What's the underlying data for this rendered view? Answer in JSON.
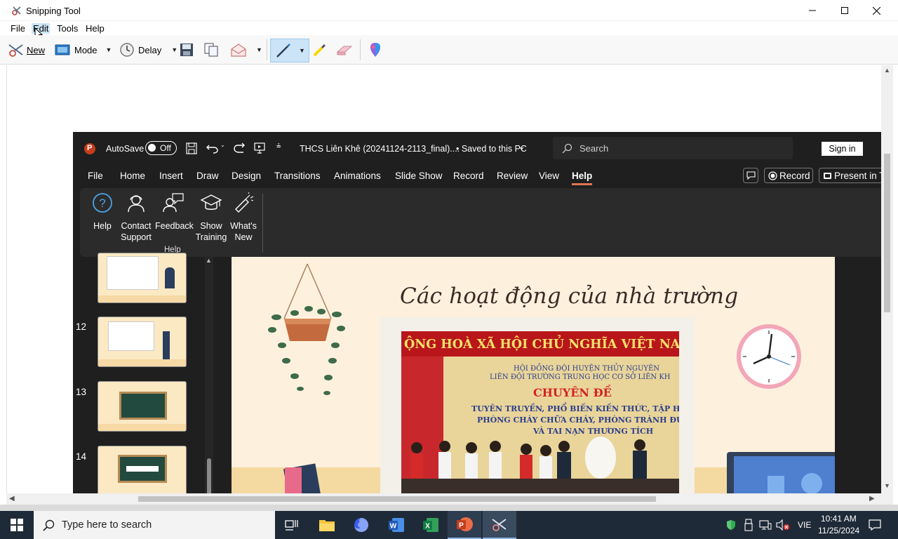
{
  "window": {
    "title": "Snipping Tool",
    "menu": [
      "File",
      "Edit",
      "Tools",
      "Help"
    ],
    "toolbar": {
      "new_label": "New",
      "mode_label": "Mode",
      "delay_label": "Delay"
    }
  },
  "ppt": {
    "autosave_label": "AutoSave",
    "toggle_state": "Off",
    "doc_title": "THCS Liên Khê (20241124-2113_final)....",
    "saved_status": "• Saved to this PC",
    "search_placeholder": "Search",
    "signin_label": "Sign in",
    "tabs": [
      "File",
      "Home",
      "Insert",
      "Draw",
      "Design",
      "Transitions",
      "Animations",
      "Slide Show",
      "Record",
      "Review",
      "View",
      "Help"
    ],
    "active_tab": "Help",
    "record_btn": "Record",
    "present_btn": "Present in T",
    "ribbon": {
      "items": [
        {
          "l1": "Help",
          "l2": ""
        },
        {
          "l1": "Contact",
          "l2": "Support"
        },
        {
          "l1": "Feedback",
          "l2": ""
        },
        {
          "l1": "Show",
          "l2": "Training"
        },
        {
          "l1": "What's",
          "l2": "New"
        }
      ],
      "group_label": "Help"
    },
    "slide_numbers": [
      "12",
      "13",
      "14"
    ],
    "slide_title": "Các hoạt động của nhà trường",
    "banner_line1": "ỘNG HOÀ XÃ HỘI CHỦ NGHĨA VIỆT NAM MUÔN",
    "board_line1": "HỘI ĐỒNG ĐỘI HUYỆN THỦY NGUYÊN",
    "board_line2": "LIÊN ĐỘI TRƯỜNG TRUNG HỌC CƠ SỞ LIÊN KH",
    "board_line3": "CHUYÊN ĐỀ",
    "board_line4": "TUYÊN TRUYỀN, PHỔ BIẾN KIẾN THỨC, TẬP HUẤN KỸ",
    "board_line5": "PHÒNG CHÁY CHỮA CHÁY, PHÒNG TRÁNH ĐUỐI NƯỚC",
    "board_line6": "VÀ TAI NẠN THƯƠNG TÍCH"
  },
  "taskbar": {
    "search_placeholder": "Type here to search",
    "lang": "VIE",
    "time": "10:41 AM",
    "date": "11/25/2024"
  },
  "colors": {
    "ppt_dark": "#1f1f1f",
    "slide_bg": "#fdf1dd",
    "banner_red": "#b8161a",
    "taskbar": "#1f2a38",
    "ppt_accent": "#c43e1c"
  }
}
